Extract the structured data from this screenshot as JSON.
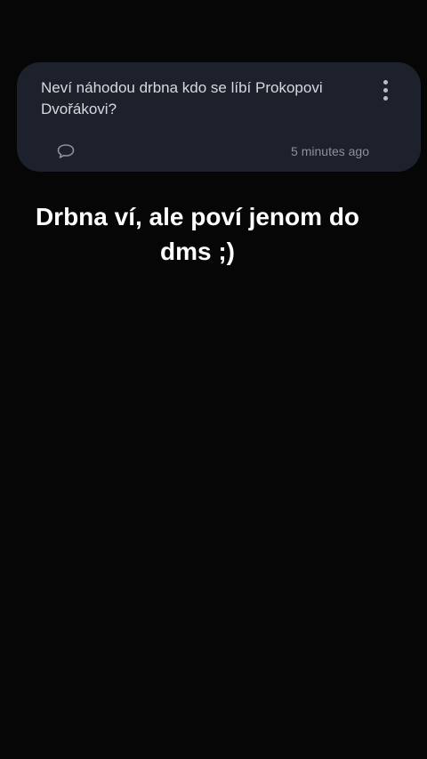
{
  "question_card": {
    "text": "Neví náhodou drbna kdo se líbí Prokopovi Dvořákovi?",
    "timestamp": "5 minutes ago",
    "more_icon": "more-vertical-icon",
    "comment_icon": "comment-bubble-icon"
  },
  "reply": {
    "line1": "Drbna ví, ale poví jenom do",
    "line2": "dms ;)"
  },
  "colors": {
    "background": "#060606",
    "card": "#1d212b",
    "question_text": "#d6d9df",
    "timestamp_text": "#8c919b",
    "reply_text": "#ffffff"
  }
}
